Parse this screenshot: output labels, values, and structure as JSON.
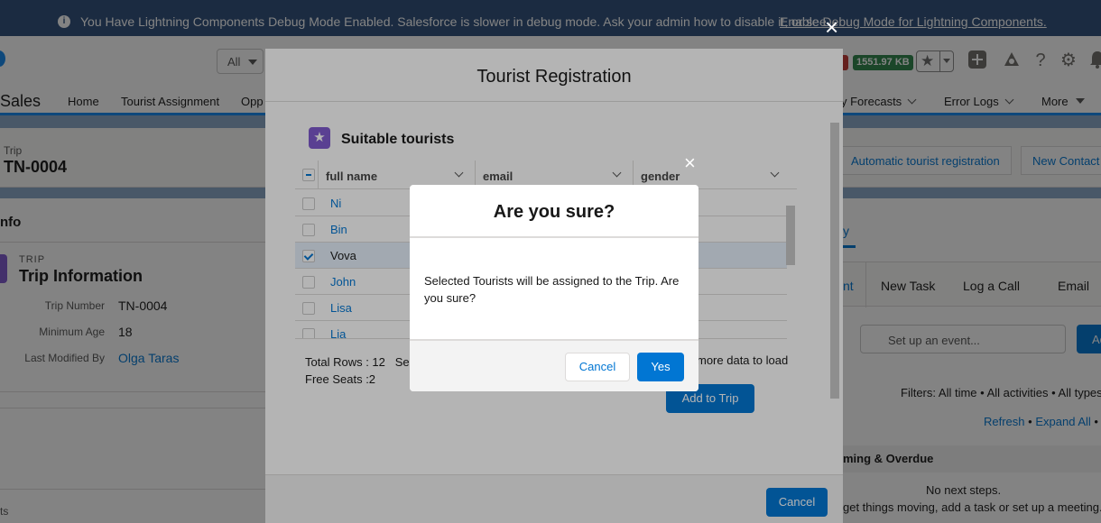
{
  "debug_banner": {
    "info_icon": "i",
    "message": "You Have Lightning Components Debug Mode Enabled. Salesforce is slower in debug mode. Ask your admin how to disable it, or see",
    "link": "Enable Debug Mode for Lightning Components."
  },
  "header": {
    "search_scope": "All",
    "memory_badge": "1551.97 KB",
    "icons": [
      "favorites-star-icon",
      "add-icon",
      "trailhead-icon",
      "help-icon",
      "settings-icon",
      "notifications-icon"
    ]
  },
  "navbar": {
    "app_name": "Sales",
    "items": [
      {
        "label": "Home"
      },
      {
        "label": "Tourist Assignment"
      },
      {
        "label": "Opp"
      },
      {
        "label": "y Forecasts"
      },
      {
        "label": "Error Logs"
      },
      {
        "label": "More"
      }
    ]
  },
  "record": {
    "object_label": "Trip",
    "name": "TN-0004",
    "actions": [
      "Automatic tourist registration",
      "New Contact"
    ]
  },
  "details": {
    "card_title": "nfo",
    "section_caption": "TRIP",
    "section_title": "Trip Information",
    "fields": [
      {
        "label": "Trip Number",
        "value": "TN-0004"
      },
      {
        "label": "Minimum Age",
        "value": "18"
      },
      {
        "label": "Last Modified By",
        "value": "Olga Taras"
      }
    ],
    "bottom_text": "ts"
  },
  "activity": {
    "tab_fragment": "y",
    "publisher_tabs": [
      "nt",
      "New Task",
      "Log a Call",
      "Email"
    ],
    "event_placeholder": "Set up an event...",
    "add_label": "Ad",
    "filters": "Filters: All time • All activities • All types",
    "refresh": "Refresh",
    "bullet": "•",
    "expand_all": "Expand All",
    "upcoming": "ming & Overdue",
    "no_next": "No next steps.",
    "get_moving": "get things moving, add a task or set up a meeting."
  },
  "registration_modal": {
    "title": "Tourist Registration",
    "section_title": "Suitable tourists",
    "columns": [
      "full name",
      "email",
      "gender"
    ],
    "rows": [
      {
        "name": "Ni",
        "selected": false
      },
      {
        "name": "Bin",
        "selected": false
      },
      {
        "name": "Vova",
        "selected": true
      },
      {
        "name": "John",
        "selected": false
      },
      {
        "name": "Lisa",
        "selected": false
      },
      {
        "name": "Lia",
        "selected": false
      }
    ],
    "total_rows": "Total Rows : 12",
    "selected_fragment": "Sel",
    "free_seats": "Free Seats :2",
    "more_data": "more data to load",
    "add_to_trip": "Add to Trip",
    "cancel": "Cancel"
  },
  "confirm_dialog": {
    "title": "Are you sure?",
    "body": "Selected Tourists will be assigned to the Trip. Are you sure?",
    "cancel": "Cancel",
    "yes": "Yes"
  },
  "close_glyph": "×"
}
